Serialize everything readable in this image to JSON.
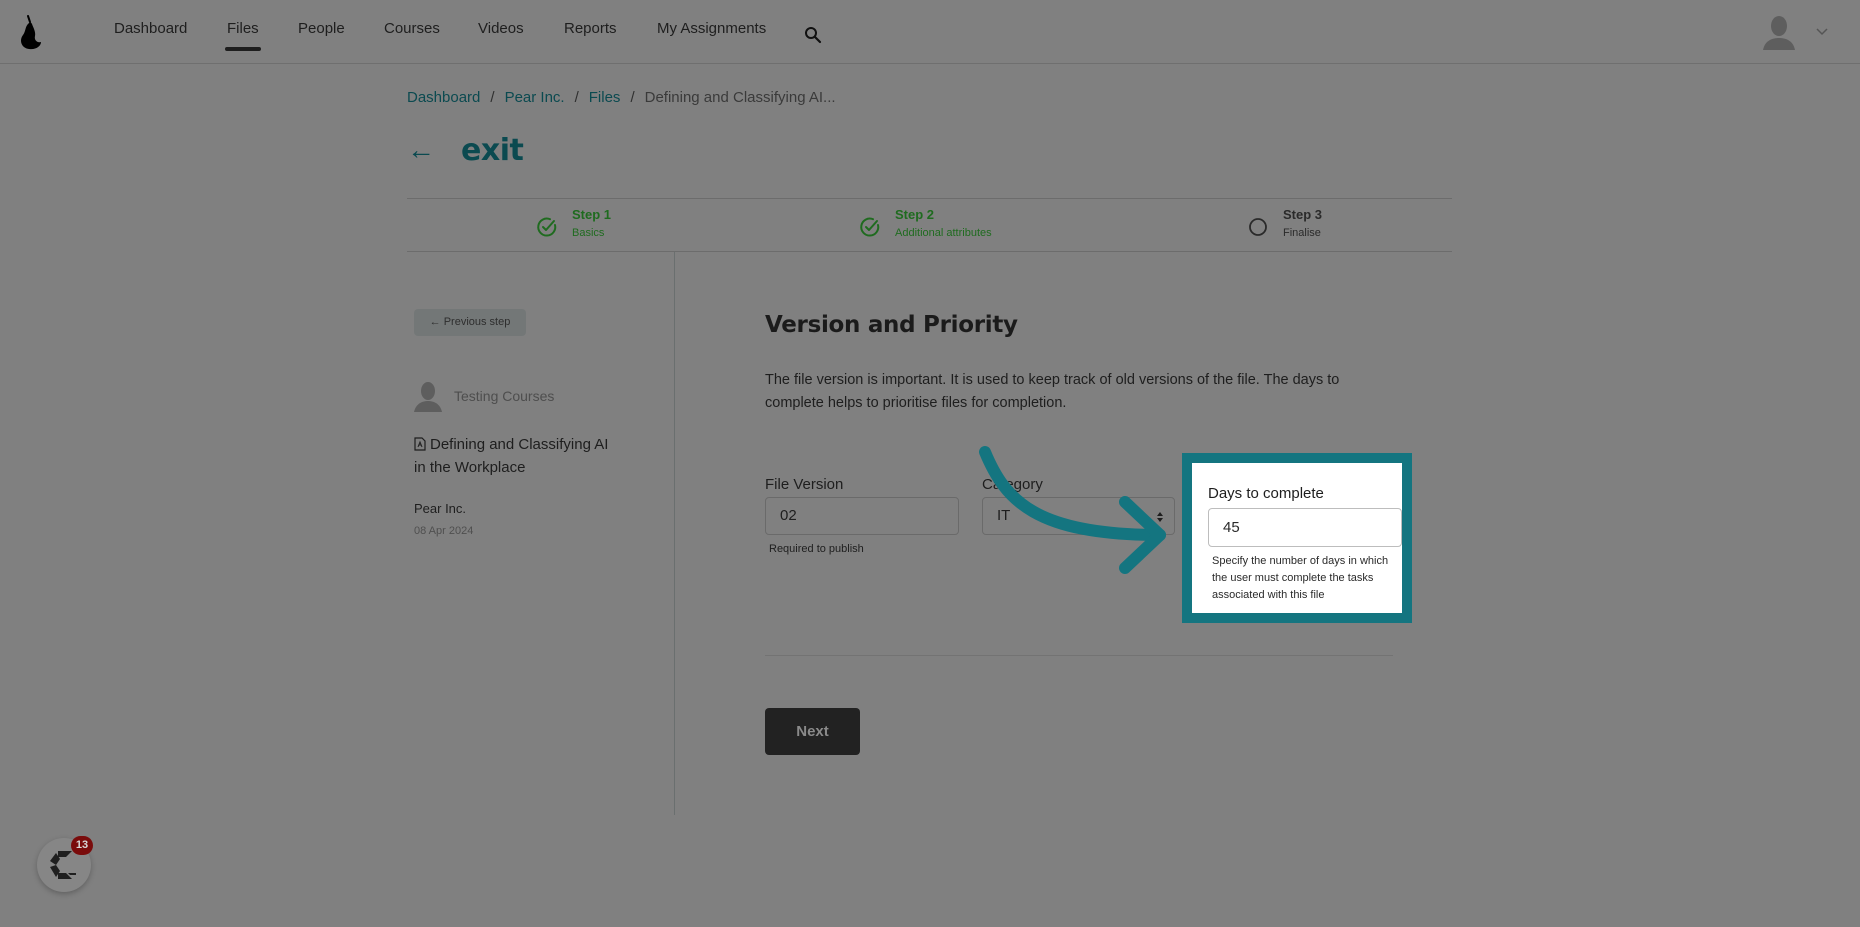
{
  "nav": {
    "items": [
      {
        "label": "Dashboard",
        "active": false
      },
      {
        "label": "Files",
        "active": true
      },
      {
        "label": "People",
        "active": false
      },
      {
        "label": "Courses",
        "active": false
      },
      {
        "label": "Videos",
        "active": false
      },
      {
        "label": "Reports",
        "active": false
      },
      {
        "label": "My Assignments",
        "active": false
      }
    ],
    "icons": {
      "logo": "pear-logo-icon",
      "search": "search-icon",
      "avatar": "user-avatar-icon",
      "menu": "chevron-down-icon"
    }
  },
  "breadcrumb": {
    "items": [
      "Dashboard",
      "Pear Inc.",
      "Files"
    ],
    "current": "Defining and Classifying AI...",
    "separator": "/"
  },
  "exit": {
    "arrow": "←",
    "label": "exit"
  },
  "stepper": {
    "steps": [
      {
        "title": "Step 1",
        "subtitle": "Basics",
        "status": "done"
      },
      {
        "title": "Step 2",
        "subtitle": "Additional attributes",
        "status": "done"
      },
      {
        "title": "Step 3",
        "subtitle": "Finalise",
        "status": "todo"
      }
    ],
    "done_color": "#1f6b1f"
  },
  "sidebar": {
    "previous_step": "← Previous step",
    "owner": "Testing Courses",
    "file_title": "Defining and Classifying AI in the Workplace",
    "organization": "Pear Inc.",
    "date": "08 Apr 2024"
  },
  "main": {
    "title": "Version and Priority",
    "description": "The file version is important. It is used to keep track of old versions of the file. The days to complete helps to prioritise files for completion.",
    "fields": {
      "file_version": {
        "label": "File Version",
        "value": "02",
        "help": "Required to publish"
      },
      "category": {
        "label": "Category",
        "value": "IT"
      },
      "days_to_complete": {
        "label": "Days to complete",
        "value": "45",
        "help": "Specify the number of days in which the user must complete the tasks associated with this file"
      }
    },
    "next_label": "Next"
  },
  "highlight": {
    "color": "#147580"
  },
  "widget": {
    "badge_count": "13"
  }
}
